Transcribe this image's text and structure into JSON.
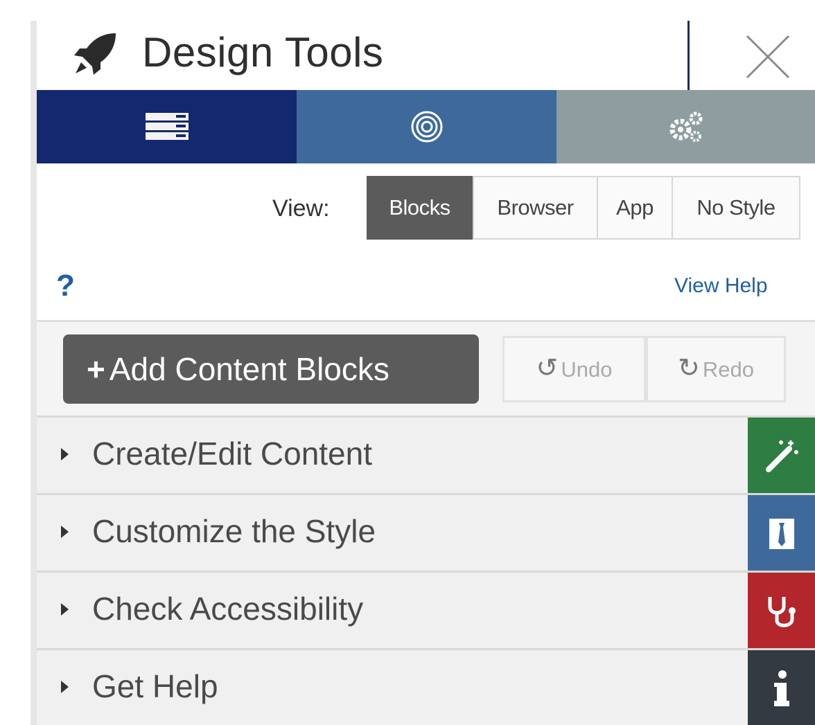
{
  "header": {
    "title": "Design Tools",
    "icon": "rocket-icon",
    "close_icon": "close-icon"
  },
  "tabs": [
    {
      "name": "layout",
      "icon": "server-icon",
      "color": "#13286e"
    },
    {
      "name": "target",
      "icon": "target-icon",
      "color": "#3d6a9a"
    },
    {
      "name": "settings",
      "icon": "gears-icon",
      "color": "#8e9ea0"
    }
  ],
  "view": {
    "label": "View:",
    "options": [
      "Blocks",
      "Browser",
      "App",
      "No Style"
    ],
    "selected": "Blocks"
  },
  "help": {
    "icon_text": "?",
    "link": "View Help"
  },
  "toolbar": {
    "add_label": "Add Content Blocks",
    "undo_label": "Undo",
    "redo_label": "Redo"
  },
  "sections": [
    {
      "label": "Create/Edit Content",
      "icon": "magic-wand-icon",
      "color": "#2e7d43"
    },
    {
      "label": "Customize the Style",
      "icon": "tie-icon",
      "color": "#3d6a9a"
    },
    {
      "label": "Check Accessibility",
      "icon": "stethoscope-icon",
      "color": "#b3262b"
    },
    {
      "label": "Get Help",
      "icon": "info-icon",
      "color": "#333a41"
    }
  ]
}
